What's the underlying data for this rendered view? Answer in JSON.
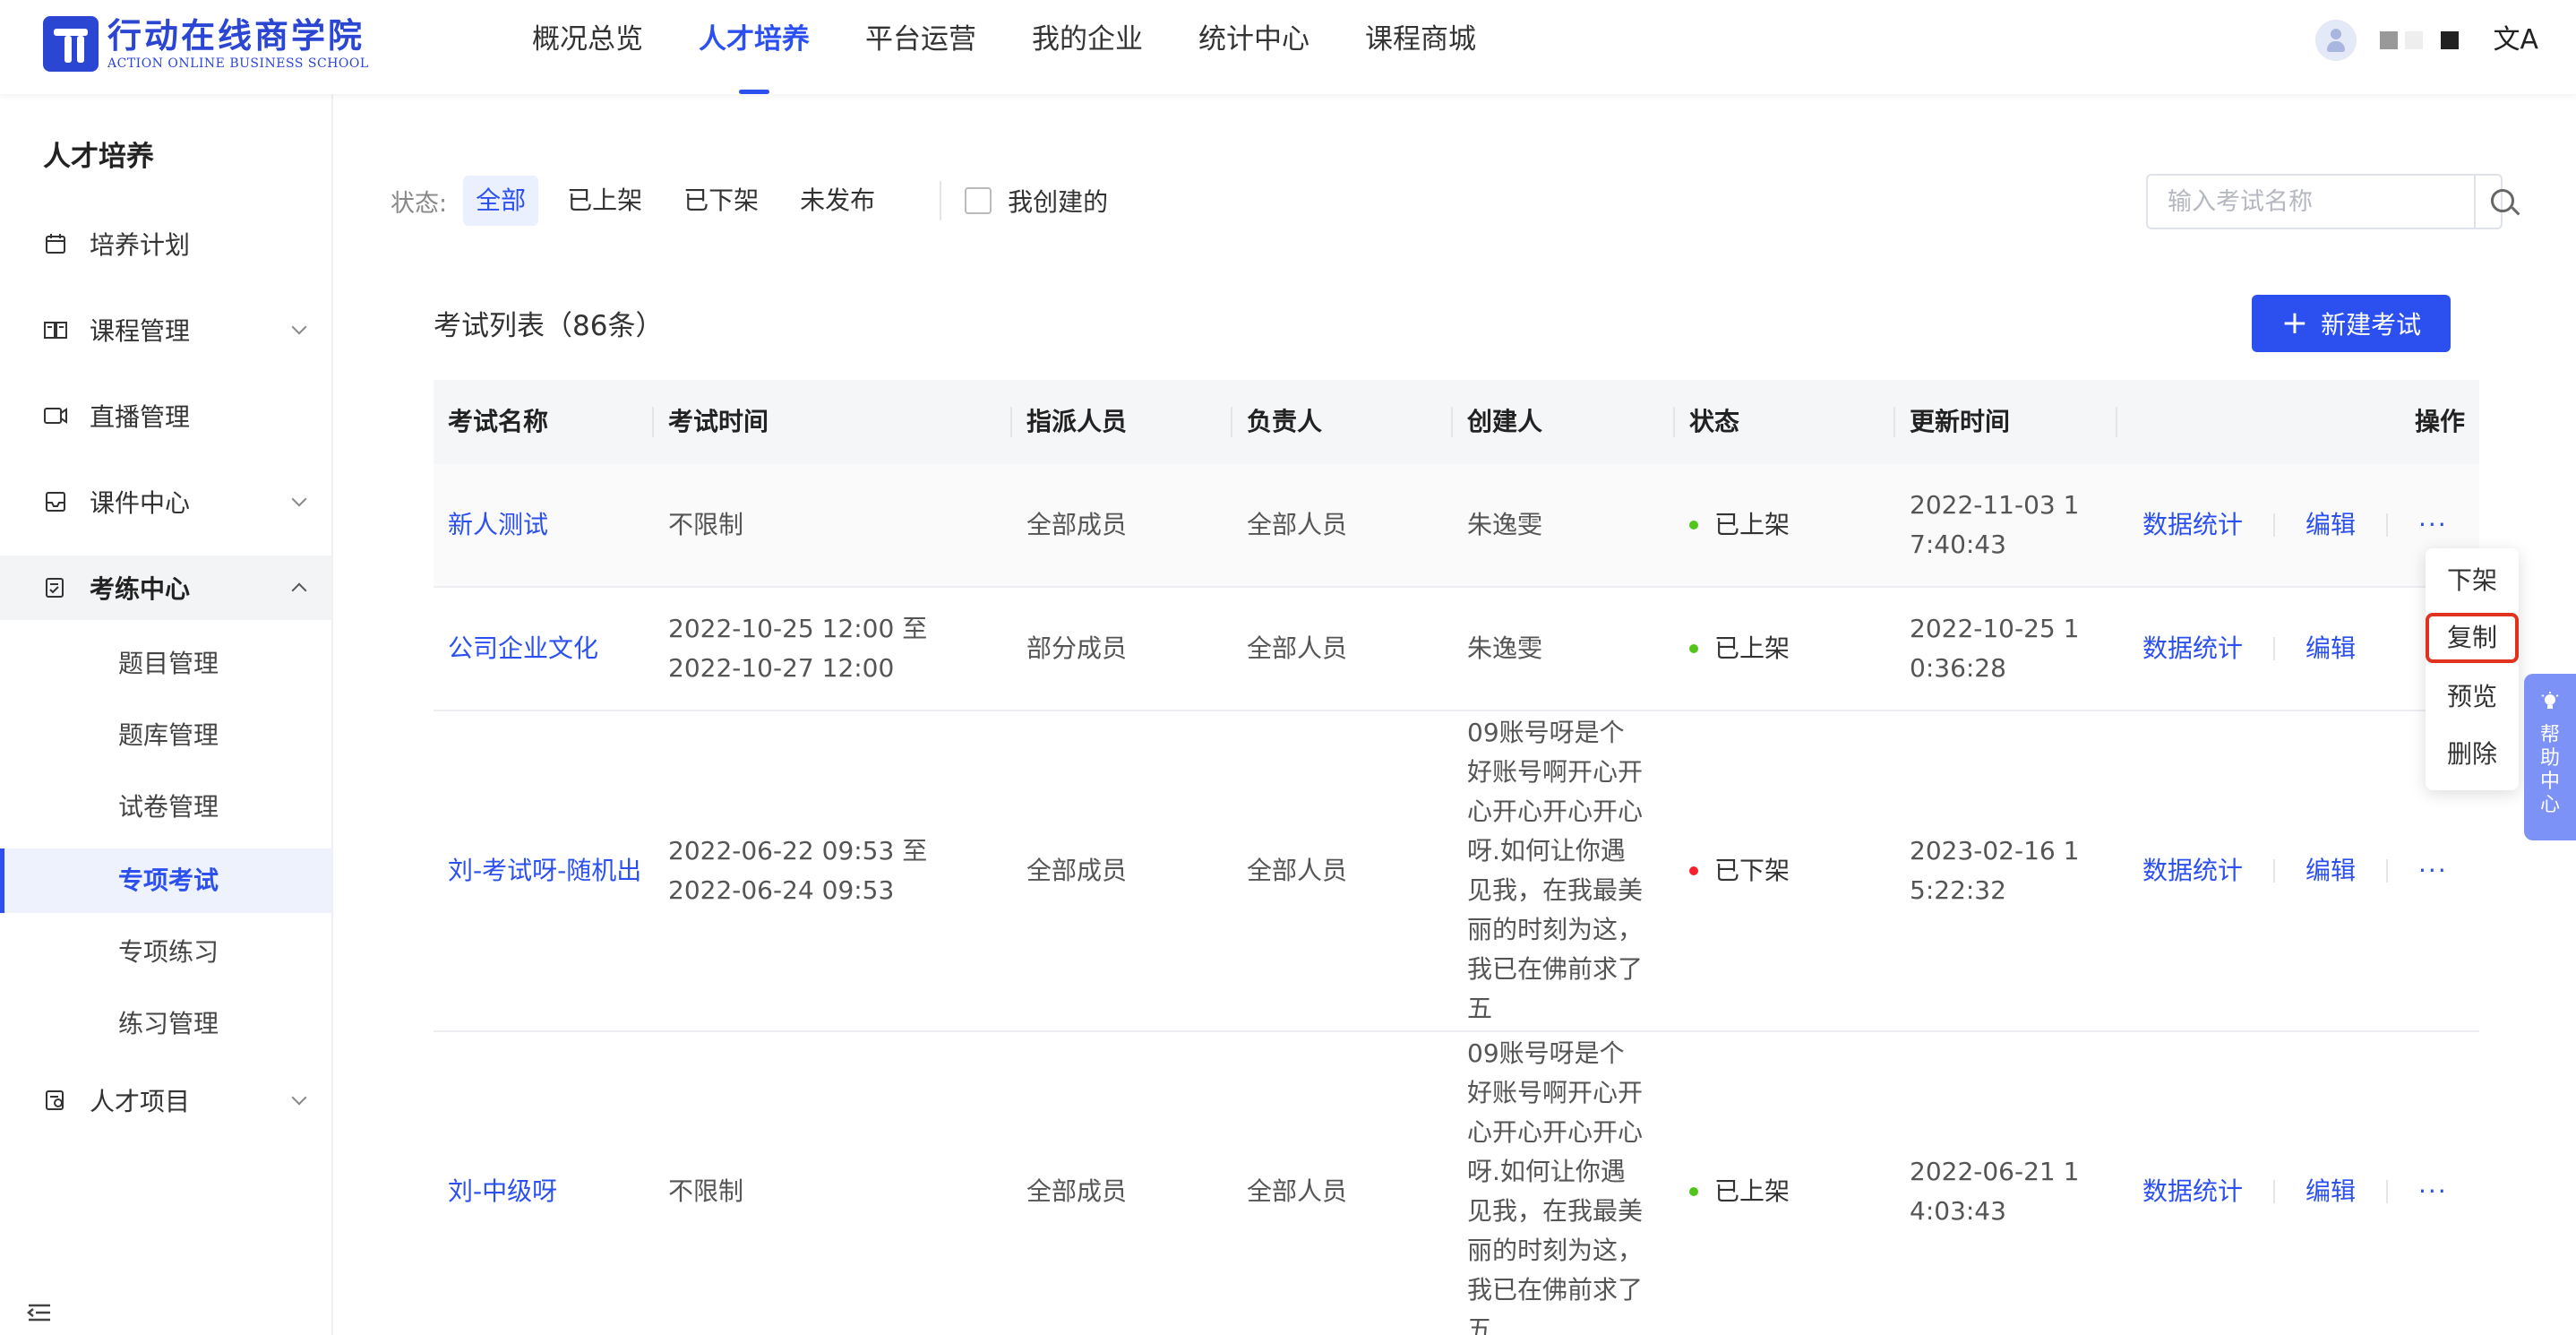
{
  "header": {
    "logo_cn": "行动在线商学院",
    "logo_en": "ACTION ONLINE BUSINESS SCHOOL",
    "nav": [
      "概况总览",
      "人才培养",
      "平台运营",
      "我的企业",
      "统计中心",
      "课程商城"
    ],
    "active_nav_index": 1,
    "lang_icon": "文A"
  },
  "sidebar": {
    "title": "人才培养",
    "items": [
      {
        "label": "培养计划",
        "icon": "calendar-icon"
      },
      {
        "label": "课程管理",
        "icon": "book-icon"
      },
      {
        "label": "直播管理",
        "icon": "video-icon"
      },
      {
        "label": "课件中心",
        "icon": "inbox-icon"
      },
      {
        "label": "考练中心",
        "icon": "exam-icon"
      },
      {
        "label": "人才项目",
        "icon": "project-icon"
      }
    ],
    "sub_items": [
      "题目管理",
      "题库管理",
      "试卷管理",
      "专项考试",
      "专项练习",
      "练习管理"
    ],
    "active_sub_index": 3
  },
  "filter": {
    "label": "状态:",
    "options": [
      "全部",
      "已上架",
      "已下架",
      "未发布"
    ],
    "active_index": 0,
    "my_created": "我创建的"
  },
  "search": {
    "placeholder": "输入考试名称"
  },
  "list": {
    "title": "考试列表（86条）",
    "new_button": "新建考试"
  },
  "table": {
    "columns": [
      "考试名称",
      "考试时间",
      "指派人员",
      "负责人",
      "创建人",
      "状态",
      "更新时间",
      "操作"
    ],
    "rows": [
      {
        "name": "新人测试",
        "time": "不限制",
        "assignee": "全部成员",
        "owner": "全部人员",
        "creator": "朱逸雯",
        "status": "已上架",
        "updated": "2022-11-03 17:40:43"
      },
      {
        "name": "公司企业文化",
        "time": "2022-10-25 12:00 至 2022-10-27 12:00",
        "assignee": "部分成员",
        "owner": "全部人员",
        "creator": "朱逸雯",
        "status": "已上架",
        "updated": "2022-10-25 10:36:28"
      },
      {
        "name": "刘-考试呀-随机出",
        "time": "2022-06-22 09:53 至 2022-06-24 09:53",
        "assignee": "全部成员",
        "owner": "全部人员",
        "creator": "09账号呀是个好账号啊开心开心开心开心开心呀.如何让你遇见我，在我最美丽的时刻为这，我已在佛前求了五",
        "status": "已下架",
        "updated": "2023-02-16 15:22:32"
      },
      {
        "name": "刘-中级呀",
        "time": "不限制",
        "assignee": "全部成员",
        "owner": "全部人员",
        "creator": "09账号呀是个好账号啊开心开心开心开心开心呀.如何让你遇见我，在我最美丽的时刻为这，我已在佛前求了五",
        "status": "已上架",
        "updated": "2022-06-21 14:03:43"
      }
    ],
    "actions": {
      "stats": "数据统计",
      "edit": "编辑",
      "more": "···"
    }
  },
  "popover": {
    "items": [
      "下架",
      "复制",
      "预览",
      "删除"
    ],
    "focused_index": 1
  },
  "help": {
    "label": "帮助中心"
  },
  "colors": {
    "accent": "#2c50f0",
    "status_on": "#52c41a",
    "status_off": "#f5222d",
    "focus_ring": "#e0321f"
  }
}
